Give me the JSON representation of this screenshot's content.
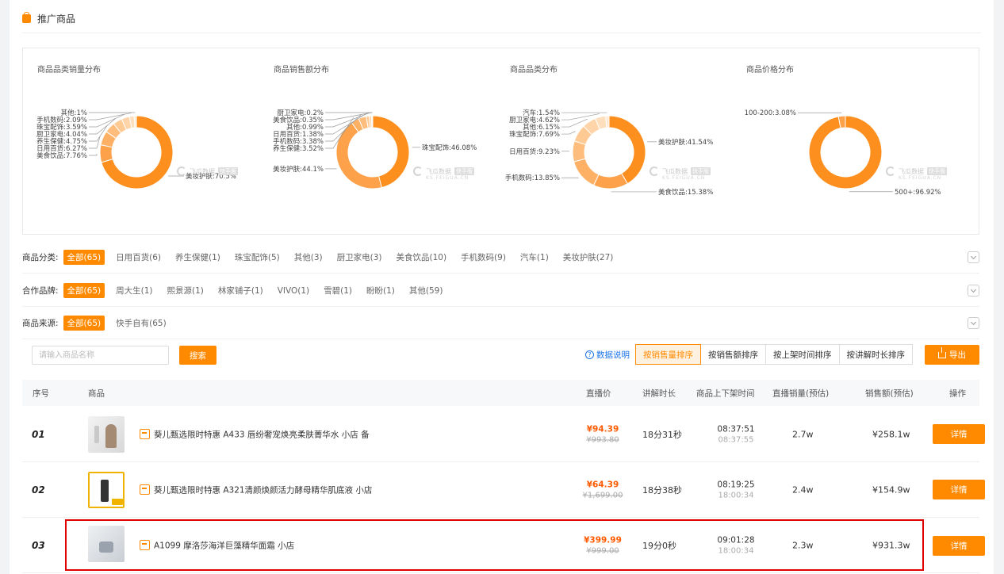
{
  "section": {
    "title": "推广商品"
  },
  "charts": [
    {
      "title": "商品品类销量分布"
    },
    {
      "title": "商品销售额分布"
    },
    {
      "title": "商品品类分布"
    },
    {
      "title": "商品价格分布"
    }
  ],
  "watermark": {
    "brand": "飞瓜数据",
    "tag": "快手版",
    "url": "KS.FEIGUA.CN"
  },
  "chart_data": [
    {
      "type": "pie",
      "title": "商品品类销量分布",
      "labels": [
        "美妆护肤",
        "美食饮品",
        "日用百货",
        "养生保健",
        "厨卫家电",
        "珠宝配饰",
        "手机数码",
        "其他"
      ],
      "values": [
        70.5,
        7.76,
        6.27,
        4.75,
        4.04,
        3.59,
        2.09,
        1
      ],
      "slice_labels": [
        "美妆护肤:70.5%",
        "美食饮品:7.76%",
        "日用百货:6.27%",
        "养生保健:4.75%",
        "厨卫家电:4.04%",
        "珠宝配饰:3.59%",
        "手机数码:2.09%",
        "其他:1%"
      ]
    },
    {
      "type": "pie",
      "title": "商品销售额分布",
      "labels": [
        "珠宝配饰",
        "美妆护肤",
        "养生保健",
        "手机数码",
        "日用百货",
        "其他",
        "美食饮品",
        "厨卫家电"
      ],
      "values": [
        46.08,
        44.1,
        3.52,
        3.38,
        1.38,
        0.99,
        0.35,
        0.2
      ],
      "slice_labels": [
        "珠宝配饰:46.08%",
        "美妆护肤:44.1%",
        "养生保健:3.52%",
        "手机数码:3.38%",
        "日用百货:1.38%",
        "其他:0.99%",
        "美食饮品:0.35%",
        "厨卫家电:0.2%"
      ]
    },
    {
      "type": "pie",
      "title": "商品品类分布",
      "labels": [
        "美妆护肤",
        "美食饮品",
        "手机数码",
        "日用百货",
        "珠宝配饰",
        "其他",
        "厨卫家电",
        "汽车"
      ],
      "values": [
        41.54,
        15.38,
        13.85,
        9.23,
        7.69,
        6.15,
        4.62,
        1.54
      ],
      "slice_labels": [
        "美妆护肤:41.54%",
        "美食饮品:15.38%",
        "手机数码:13.85%",
        "日用百货:9.23%",
        "珠宝配饰:7.69%",
        "其他:6.15%",
        "厨卫家电:4.62%",
        "汽车:1.54%"
      ]
    },
    {
      "type": "pie",
      "title": "商品价格分布",
      "labels": [
        "500+",
        "100-200"
      ],
      "values": [
        96.92,
        3.08
      ],
      "slice_labels": [
        "500+:96.92%",
        "100-200:3.08%"
      ]
    }
  ],
  "filters": {
    "category": {
      "label": "商品分类:",
      "chips": [
        "全部(65)",
        "日用百货(6)",
        "养生保健(1)",
        "珠宝配饰(5)",
        "其他(3)",
        "厨卫家电(3)",
        "美食饮品(10)",
        "手机数码(9)",
        "汽车(1)",
        "美妆护肤(27)"
      ]
    },
    "brand": {
      "label": "合作品牌:",
      "chips": [
        "全部(65)",
        "周大生(1)",
        "熙景源(1)",
        "林家铺子(1)",
        "VIVO(1)",
        "雪碧(1)",
        "盼盼(1)",
        "其他(59)"
      ]
    },
    "source": {
      "label": "商品来源:",
      "chips": [
        "全部(65)",
        "快手自有(65)"
      ]
    }
  },
  "toolbar": {
    "search_placeholder": "请输入商品名称",
    "search_label": "搜索",
    "help_label": "数据说明",
    "sorts": [
      "按销售量排序",
      "按销售额排序",
      "按上架时间排序",
      "按讲解时长排序"
    ],
    "export_label": "导出"
  },
  "table": {
    "headers": {
      "idx": "序号",
      "product": "商品",
      "price": "直播价",
      "duration": "讲解时长",
      "times": "商品上下架时间",
      "sales": "直播销量(预估)",
      "revenue": "销售额(预估)",
      "action": "操作"
    },
    "rows": [
      {
        "idx": "01",
        "name": "葵儿甄选限时特惠 A433 唇纷奢宠焕亮柔肤菁华水 小店 备",
        "price": "¥94.39",
        "orig": "¥993.80",
        "duration": "18分31秒",
        "up": "08:37:51",
        "down": "08:37:55",
        "sales": "2.7w",
        "revenue": "¥258.1w",
        "action": "详情"
      },
      {
        "idx": "02",
        "name": "葵儿甄选限时特惠 A321清颜焕颜活力酵母精华肌底液 小店",
        "price": "¥64.39",
        "orig": "¥1,699.00",
        "duration": "18分38秒",
        "up": "08:19:25",
        "down": "18:00:34",
        "sales": "2.4w",
        "revenue": "¥154.9w",
        "action": "详情"
      },
      {
        "idx": "03",
        "name": "A1099 摩洛莎海洋巨藻精华面霜 小店",
        "price": "¥399.99",
        "orig": "¥999.00",
        "duration": "19分0秒",
        "up": "09:01:28",
        "down": "18:00:34",
        "sales": "2.3w",
        "revenue": "¥931.3w",
        "action": "详情"
      }
    ]
  },
  "colors": {
    "accent": "#ff8a00",
    "price": "#ff5a00",
    "link": "#1a73e8",
    "highlight": "#e00000"
  }
}
